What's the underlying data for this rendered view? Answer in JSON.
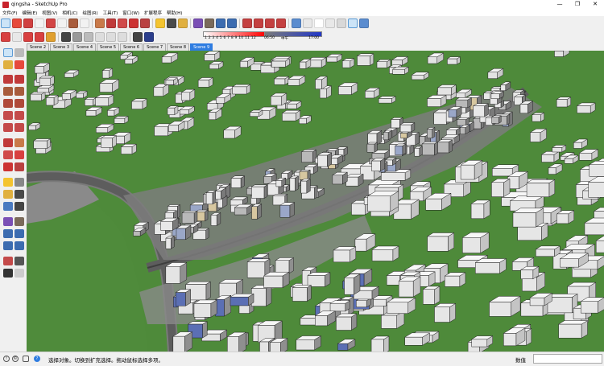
{
  "window": {
    "title": "qingsha - SketchUp Pro",
    "controls": [
      "—",
      "❐",
      "✕"
    ]
  },
  "menu": [
    "文件(F)",
    "编辑(E)",
    "视图(V)",
    "相机(C)",
    "绘图(R)",
    "工具(T)",
    "窗口(W)",
    "扩展程序",
    "帮助(H)"
  ],
  "shadow_toolbar": {
    "month_numbers": "1  2  3  4  5  6  7  8  9  10  11  12",
    "time_start": "06:50",
    "time_mid": "中午",
    "time_end": "17:00"
  },
  "scenes": [
    "Scene 2",
    "Scene 3",
    "Scene 4",
    "Scene 5",
    "Scene 6",
    "Scene 7",
    "Scene 8",
    "Scene 9"
  ],
  "active_scene": "Scene 9",
  "status": {
    "help_text": "选择对象。切换到扩充选择。拖动鼠标选择多项。",
    "measurements_label": "数值",
    "measurements_value": ""
  },
  "colors": {
    "ground": "#4e8a3a",
    "road": "#5d5d5d",
    "building": "#eeeeee",
    "scene_active": "#2f7de1"
  }
}
